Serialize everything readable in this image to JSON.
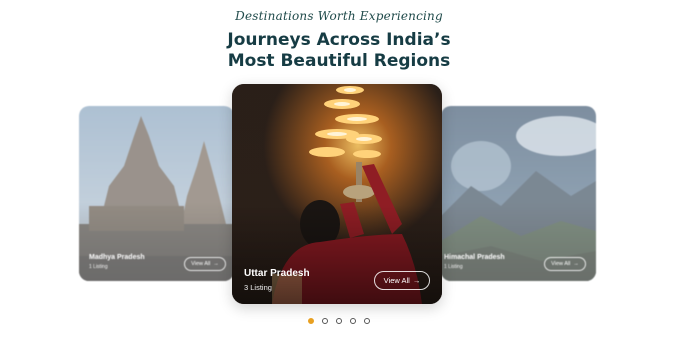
{
  "header": {
    "eyebrow": "Destinations Worth Experiencing",
    "title_line1": "Journeys Across India’s",
    "title_line2": "Most Beautiful Regions"
  },
  "cards": [
    {
      "name": "Madhya Pradesh",
      "count": "1 Listing",
      "button": "View All"
    },
    {
      "name": "Uttar Pradesh",
      "count": "3 Listing",
      "button": "View All"
    },
    {
      "name": "Himachal Pradesh",
      "count": "1 Listing",
      "button": "View All"
    }
  ],
  "pagination": {
    "total": 5,
    "active": 0
  },
  "colors": {
    "accent": "#e8a021",
    "heading": "#163c44",
    "eyebrow": "#1f4a4a"
  },
  "icons": {
    "button_arrow": "arrow-right-icon"
  }
}
